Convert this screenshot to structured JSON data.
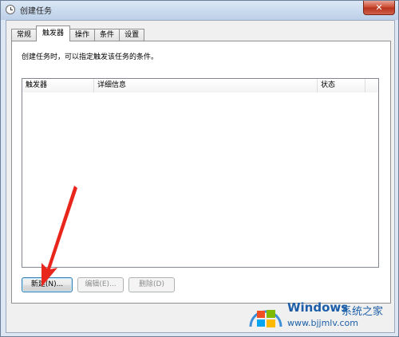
{
  "window": {
    "title": "创建任务",
    "close_label": "✕"
  },
  "tabs": [
    {
      "label": "常规"
    },
    {
      "label": "触发器"
    },
    {
      "label": "操作"
    },
    {
      "label": "条件"
    },
    {
      "label": "设置"
    }
  ],
  "active_tab": "触发器",
  "panel": {
    "description": "创建任务时，可以指定触发该任务的条件。"
  },
  "list": {
    "columns": [
      "触发器",
      "详细信息",
      "状态",
      ""
    ],
    "rows": []
  },
  "buttons": {
    "new_label": "新建(N)...",
    "edit_label": "编辑(E)...",
    "delete_label": "删除(D)"
  },
  "watermark": {
    "brand": "Windows",
    "sub": "系统之家",
    "url": "www.bjjmlv.com"
  }
}
